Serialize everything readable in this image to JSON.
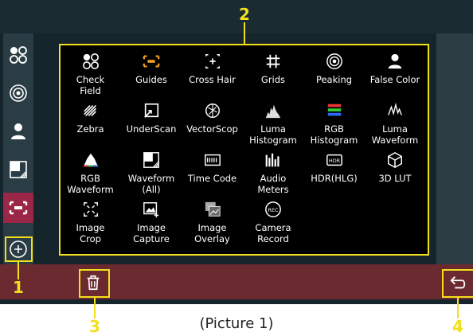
{
  "tools": [
    {
      "label": "Check\nField",
      "icon": "check-field-icon"
    },
    {
      "label": "Guides",
      "icon": "guides-icon"
    },
    {
      "label": "Cross Hair",
      "icon": "cross-hair-icon"
    },
    {
      "label": "Grids",
      "icon": "grids-icon"
    },
    {
      "label": "Peaking",
      "icon": "peaking-icon"
    },
    {
      "label": "False Color",
      "icon": "false-color-icon"
    },
    {
      "label": "Zebra",
      "icon": "zebra-icon"
    },
    {
      "label": "UnderScan",
      "icon": "underscan-icon"
    },
    {
      "label": "VectorScop",
      "icon": "vectorscope-icon"
    },
    {
      "label": "Luma\nHistogram",
      "icon": "luma-histogram-icon"
    },
    {
      "label": "RGB\nHistogram",
      "icon": "rgb-histogram-icon"
    },
    {
      "label": "Luma\nWaveform",
      "icon": "luma-waveform-icon"
    },
    {
      "label": "RGB\nWaveform",
      "icon": "rgb-waveform-icon"
    },
    {
      "label": "Waveform\n(All)",
      "icon": "waveform-all-icon"
    },
    {
      "label": "Time Code",
      "icon": "time-code-icon"
    },
    {
      "label": "Audio\nMeters",
      "icon": "audio-meters-icon"
    },
    {
      "label": "HDR(HLG)",
      "icon": "hdr-icon"
    },
    {
      "label": "3D LUT",
      "icon": "3d-lut-icon"
    },
    {
      "label": "Image\nCrop",
      "icon": "image-crop-icon"
    },
    {
      "label": "Image\nCapture",
      "icon": "image-capture-icon"
    },
    {
      "label": "Image\nOverlay",
      "icon": "image-overlay-icon"
    },
    {
      "label": "Camera\nRecord",
      "icon": "camera-record-icon"
    }
  ],
  "callouts": {
    "one": "1",
    "two": "2",
    "three": "3",
    "four": "4"
  },
  "caption": "(Picture 1)",
  "colors": {
    "highlight": "#f2e01c",
    "active": "#9b2748",
    "bottom_bar": "#6b2a30",
    "guides_icon": "#f2a01c"
  }
}
